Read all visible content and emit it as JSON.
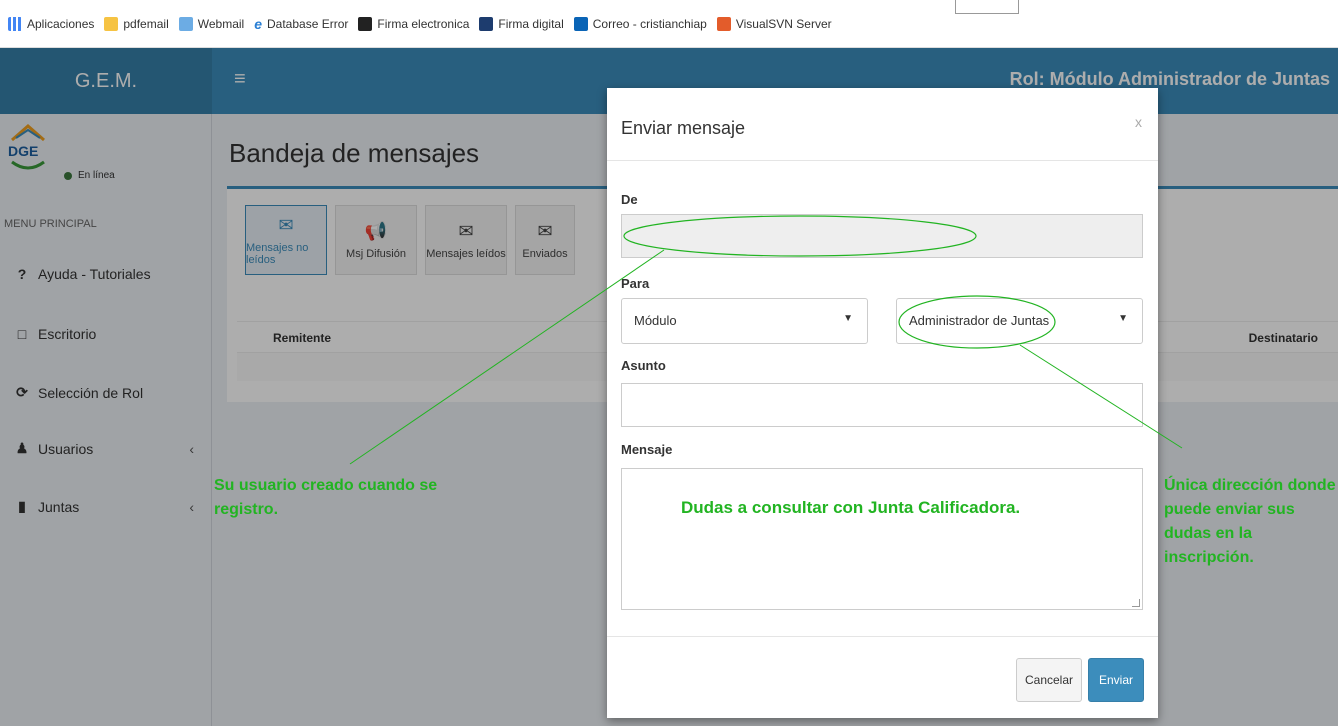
{
  "bookmarks": [
    {
      "label": "Aplicaciones",
      "icon": "apps-icon"
    },
    {
      "label": "pdfemail",
      "icon": "folder-icon"
    },
    {
      "label": "Webmail",
      "icon": "argentina-shield-icon"
    },
    {
      "label": "Database Error",
      "icon": "ie-icon"
    },
    {
      "label": "Firma electronica",
      "icon": "github-icon"
    },
    {
      "label": "Firma digital",
      "icon": "php-icon"
    },
    {
      "label": "Correo - cristianchiap",
      "icon": "outlook-icon"
    },
    {
      "label": "VisualSVN Server",
      "icon": "visualsvn-icon"
    }
  ],
  "header": {
    "brand": "G.E.M.",
    "menu_icon": "≡",
    "role": "Rol: Módulo Administrador de Juntas"
  },
  "sidebar": {
    "status": "En línea",
    "menu_header": "MENU PRINCIPAL",
    "items": [
      {
        "label": "Ayuda - Tutoriales",
        "icon": "?"
      },
      {
        "label": "Escritorio",
        "icon": "□"
      },
      {
        "label": "Selección de Rol",
        "icon": "⟳"
      },
      {
        "label": "Usuarios",
        "icon": "♟",
        "chevron": "‹"
      },
      {
        "label": "Juntas",
        "icon": "▮",
        "chevron": "‹"
      }
    ]
  },
  "content": {
    "title": "Bandeja de mensajes",
    "tabs": [
      {
        "label": "Mensajes no leídos",
        "icon": "✉"
      },
      {
        "label": "Msj Difusión",
        "icon": "📢"
      },
      {
        "label": "Mensajes leídos",
        "icon": "✉"
      },
      {
        "label": "Enviados",
        "icon": "✉"
      }
    ],
    "columns": {
      "remitente": "Remitente",
      "destinatario": "Destinatario"
    }
  },
  "modal": {
    "title": "Enviar mensaje",
    "close": "x",
    "from_label": "De",
    "from_value": "",
    "to_label": "Para",
    "to_module": "Módulo",
    "to_recipient": "Administrador de Juntas",
    "subject_label": "Asunto",
    "subject_value": "",
    "message_label": "Mensaje",
    "message_value": "",
    "cancel": "Cancelar",
    "send": "Enviar"
  },
  "annotations": {
    "left_note": "Su usuario creado cuando se registro.",
    "center_note": "Dudas a consultar con Junta Calificadora.",
    "right_note": "Única dirección donde puede enviar sus dudas en la inscripción.",
    "color": "#22b422"
  }
}
